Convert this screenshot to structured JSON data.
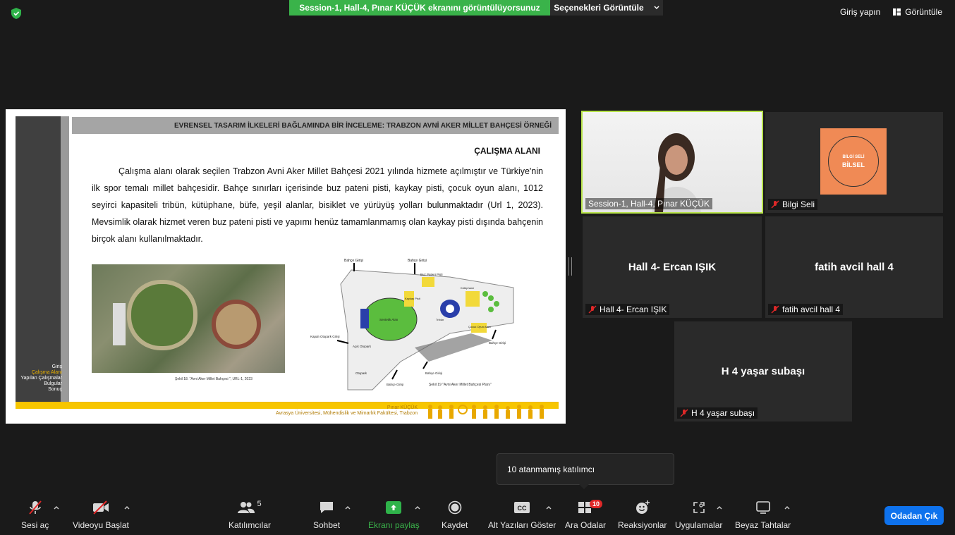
{
  "topbar": {
    "share_banner": "Session-1, Hall-4, Pınar KÜÇÜK ekranını görüntülüyorsunuz",
    "view_options": "Seçenekleri Görüntüle",
    "sign_in": "Giriş yapın",
    "view": "Görüntüle"
  },
  "slide": {
    "title": "EVRENSEL TASARIM İLKELERİ BAĞLAMINDA BİR İNCELEME: TRABZON AVNİ AKER MİLLET BAHÇESİ ÖRNEĞİ",
    "heading": "ÇALIŞMA ALANI",
    "body": "Çalışma alanı olarak seçilen Trabzon Avni Aker Millet Bahçesi 2021 yılında hizmete açılmıştır ve Türkiye'nin ilk spor temalı millet bahçesidir. Bahçe sınırları içerisinde buz pateni pisti, kaykay pisti, çocuk oyun alanı, 1012 seyirci kapasiteli tribün, kütüphane, büfe, yeşil alanlar, bisiklet ve yürüyüş yolları bulunmaktadır (Url 1, 2023). Mevsimlik olarak hizmet veren buz pateni pisti ve yapımı henüz tamamlanmamış olan kaykay pisti dışında bahçenin birçok alanı kullanılmaktadır.",
    "nav": [
      "Giriş",
      "Çalışma Alanı",
      "Yapılan Çalışmalar",
      "Bulgular",
      "Sonuç"
    ],
    "caption1": "Şekil 18. \"Avni Aker Millet Bahçesi \", URL-1, 2023",
    "caption2": "Şekil 19 \"Avni Aker Millet Bahçesi Planı\"",
    "author": "Pınar KÜÇÜK",
    "affiliation": "Avrasya Üniversitesi, Mühendislik ve Mimarlık Fakültesi, Trabzon",
    "plan_labels": {
      "entrance_top": "Bahçe Girişi",
      "entrance_top2": "Bahçe Girişi",
      "ice": "Buz Pateni Pisti",
      "skate": "Kaykay Pisti",
      "field": "Sentetik Alan",
      "library": "Kütüphane",
      "tribune": "Tribün",
      "play": "Çocuk Oyun Alanı",
      "parking_in": "Kapalı Otopark Girişi",
      "parking_out": "Açık Otopark",
      "parking2": "Otopark",
      "entrance_right": "Bahçe Girişi",
      "entrance_bottom": "Bahçe Girişi",
      "entrance_bottom2": "Bahçe Girişi"
    }
  },
  "tiles": {
    "speaker_label": "Session-1, Hall-4, Pınar KÜÇÜK",
    "bilgi_label": "Bilgi Seli",
    "bilgi_logo_top": "BİLGİ SELİ",
    "bilgi_logo_mid": "BİLSEL",
    "ercan_name": "Hall 4- Ercan IŞIK",
    "ercan_label": "Hall 4- Ercan IŞIK",
    "fatih_name": "fatih avcil hall 4",
    "fatih_label": "fatih avcil hall 4",
    "yasar_name": "H 4 yaşar subaşı",
    "yasar_label": "H 4 yaşar subaşı"
  },
  "tooltip": "10 atanmamış katılımcı",
  "toolbar": {
    "audio": "Sesi aç",
    "video": "Videoyu Başlat",
    "participants": "Katılımcılar",
    "participants_count": "5",
    "chat": "Sohbet",
    "share": "Ekranı paylaş",
    "record": "Kaydet",
    "captions": "Alt Yazıları Göster",
    "breakout": "Ara Odalar",
    "breakout_count": "10",
    "reactions": "Reaksiyonlar",
    "apps": "Uygulamalar",
    "whiteboards": "Beyaz Tahtalar",
    "leave": "Odadan Çık"
  },
  "colors": {
    "accent_green": "#3ab34a",
    "speaker_border": "#b7e34a",
    "leave_blue": "#0e72ed",
    "badge_red": "#e02828"
  }
}
